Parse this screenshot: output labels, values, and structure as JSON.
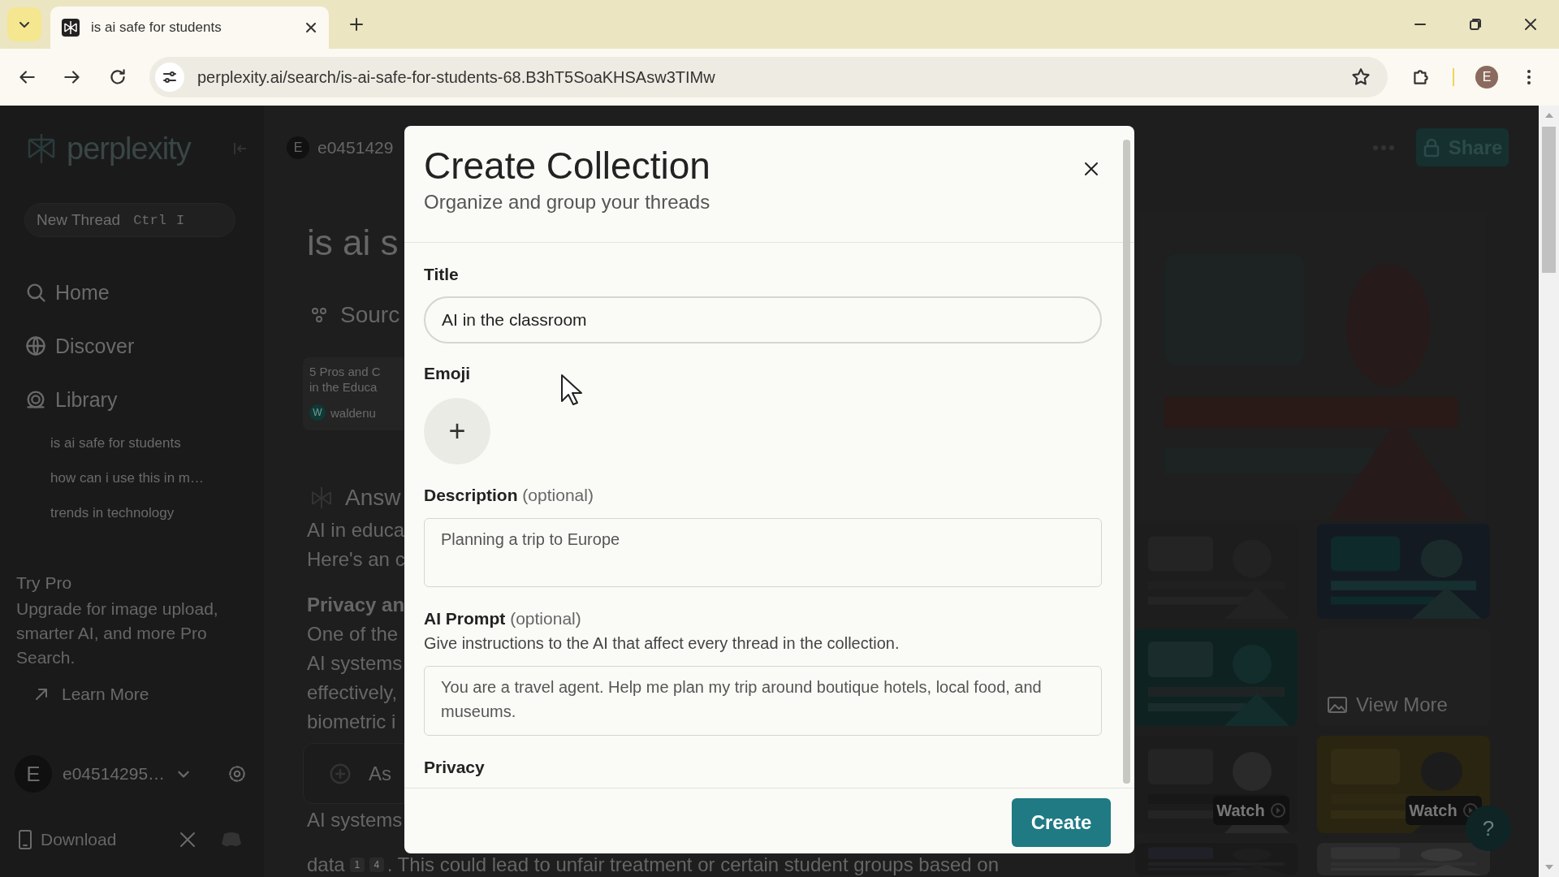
{
  "browser": {
    "tabs": [
      {
        "title": "is ai safe for students",
        "selected": true
      }
    ],
    "url": "perplexity.ai/search/is-ai-safe-for-students-68.B3hT5SoaKHSAsw3TIMw",
    "profile_initial": "E"
  },
  "sidebar": {
    "logo": "perplexity",
    "new_thread": {
      "label": "New Thread",
      "keys": [
        "Ctrl",
        "I"
      ]
    },
    "nav": [
      {
        "kind": "home",
        "label": "Home"
      },
      {
        "kind": "discover",
        "label": "Discover"
      },
      {
        "kind": "library",
        "label": "Library"
      }
    ],
    "threads": [
      "is ai safe for students",
      "how can i use this in m…",
      "trends in technology"
    ],
    "try_pro": {
      "title": "Try Pro",
      "text": "Upgrade for image upload, smarter AI, and more Pro Search.",
      "link": "Learn More"
    },
    "user": {
      "initial": "E",
      "name": "e04514295…"
    },
    "download": "Download"
  },
  "thread": {
    "user_initial": "E",
    "user_name": "e0451429",
    "title": "is ai s",
    "sources_heading": "Sourc",
    "source_card": {
      "lines": [
        "5 Pros and C",
        "in the Educa"
      ],
      "site_initial": "W",
      "site": "waldenu"
    },
    "answer_heading": "Answ",
    "lines": [
      {
        "kind": "text",
        "text": "AI in educa"
      },
      {
        "kind": "text",
        "text": "Here's an c"
      },
      {
        "kind": "heading",
        "text": "Privacy an"
      },
      {
        "kind": "text",
        "text": "One of the"
      },
      {
        "kind": "text",
        "text": "AI systems"
      },
      {
        "kind": "text",
        "text": "effectively,"
      },
      {
        "kind": "text",
        "text": "biometric i"
      },
      {
        "kind": "ask",
        "placeholder": "As"
      },
      {
        "kind": "text",
        "text": "AI systems"
      },
      {
        "kind": "cited",
        "text": "data",
        "citations": [
          "1",
          "4"
        ],
        "after": ". This could lead to unfair treatment or certain student groups based on"
      }
    ]
  },
  "results": {
    "share": "Share",
    "view_more": "View More",
    "watch": [
      "Watch",
      "Watch"
    ],
    "help": "?"
  },
  "modal": {
    "title": "Create Collection",
    "subtitle": "Organize and group your threads",
    "fields": [
      {
        "kind": "text",
        "label": "Title",
        "value": "AI in the classroom"
      },
      {
        "kind": "emoji",
        "label": "Emoji",
        "button": "+"
      },
      {
        "kind": "textarea",
        "label": "Description",
        "note": "(optional)",
        "placeholder": "Planning a trip to Europe"
      },
      {
        "kind": "textarea",
        "label": "AI Prompt",
        "note": "(optional)",
        "help": "Give instructions to the AI that affect every thread in the collection.",
        "placeholder": "You are a travel agent. Help me plan my trip around boutique hotels, local food, and museums."
      },
      {
        "kind": "section",
        "label": "Privacy"
      }
    ],
    "create": "Create"
  }
}
